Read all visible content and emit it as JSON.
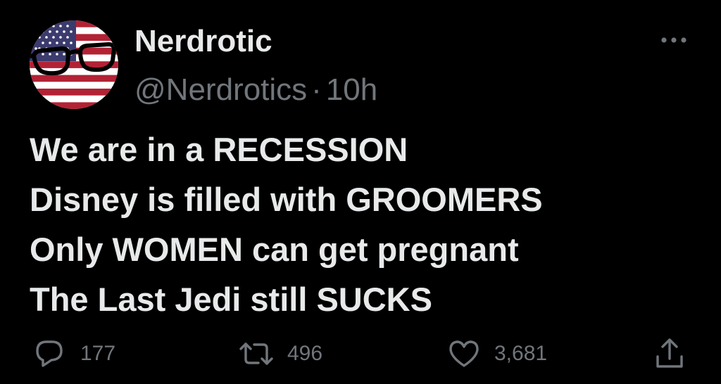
{
  "tweet": {
    "author_name": "Nerdrotic",
    "handle": "@Nerdrotics",
    "separator": "·",
    "time": "10h",
    "lines": [
      "We are in a RECESSION",
      "Disney is filled with GROOMERS",
      "Only WOMEN can get pregnant",
      "The Last Jedi still SUCKS"
    ],
    "replies": "177",
    "retweets": "496",
    "likes": "3,681"
  },
  "icons": {
    "avatar": "us-flag-glasses-avatar",
    "more": "more-options-icon",
    "reply": "reply-icon",
    "retweet": "retweet-icon",
    "like": "heart-icon",
    "share": "share-icon"
  },
  "colors": {
    "background": "#000000",
    "primary_text": "#e7e9ea",
    "secondary_text": "#71767b"
  }
}
